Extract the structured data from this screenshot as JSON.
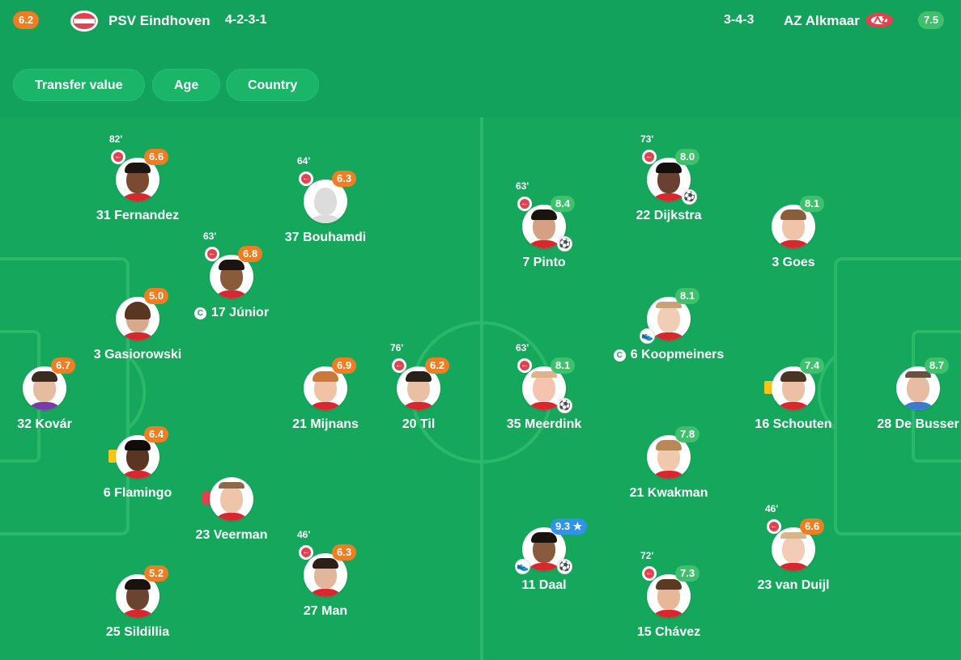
{
  "header": {
    "home": {
      "rating": "6.2",
      "name": "PSV Eindhoven",
      "formation": "4-2-3-1",
      "logo_icon": "psv-logo-icon"
    },
    "away": {
      "rating": "7.5",
      "name": "AZ Alkmaar",
      "formation": "3-4-3",
      "logo_icon": "az-logo-icon"
    }
  },
  "filters": [
    "Transfer value",
    "Age",
    "Country"
  ],
  "home_players": [
    {
      "id": "fernandez",
      "number_name": "31 Fernandez",
      "rating": "6.6",
      "minute": "82'",
      "sub_off": true
    },
    {
      "id": "bouhamdi",
      "number_name": "37 Bouhamdi",
      "rating": "6.3",
      "minute": "64'",
      "sub_off": true,
      "ghost": true
    },
    {
      "id": "junior",
      "number_name": "17 Júnior",
      "rating": "6.8",
      "minute": "63'",
      "sub_off": true,
      "captain": true
    },
    {
      "id": "gasiorowski",
      "number_name": "3 Gasiorowski",
      "rating": "5.0"
    },
    {
      "id": "kovar",
      "number_name": "32 Kovár",
      "rating": "6.7"
    },
    {
      "id": "mijnans",
      "number_name": "21 Mijnans",
      "rating": "6.9"
    },
    {
      "id": "til",
      "number_name": "20 Til",
      "rating": "6.2",
      "minute": "76'",
      "sub_off": true
    },
    {
      "id": "flamingo",
      "number_name": "6 Flamingo",
      "rating": "6.4",
      "card": "yellow"
    },
    {
      "id": "veerman",
      "number_name": "23 Veerman",
      "card": "red"
    },
    {
      "id": "man",
      "number_name": "27 Man",
      "rating": "6.3",
      "minute": "46'",
      "sub_off": true
    },
    {
      "id": "sildillia",
      "number_name": "25 Sildillia",
      "rating": "5.2"
    }
  ],
  "away_players": [
    {
      "id": "dijkstra",
      "number_name": "22 Dijkstra",
      "rating": "8.0",
      "minute": "73'",
      "sub_off": true,
      "goal": true
    },
    {
      "id": "pinto",
      "number_name": "7 Pinto",
      "rating": "8.4",
      "minute": "63'",
      "sub_off": true,
      "goal": true
    },
    {
      "id": "goes",
      "number_name": "3 Goes",
      "rating": "8.1"
    },
    {
      "id": "koopmeiners",
      "number_name": "6 Koopmeiners",
      "rating": "8.1",
      "captain": true,
      "assist": true
    },
    {
      "id": "meerdink",
      "number_name": "35 Meerdink",
      "rating": "8.1",
      "minute": "63'",
      "sub_off": true,
      "goal": true
    },
    {
      "id": "schouten",
      "number_name": "16 Schouten",
      "rating": "7.4",
      "card": "yellow"
    },
    {
      "id": "debusser",
      "number_name": "28 De Busser",
      "rating": "8.7"
    },
    {
      "id": "kwakman",
      "number_name": "21 Kwakman",
      "rating": "7.8"
    },
    {
      "id": "daal",
      "number_name": "11 Daal",
      "rating": "9.3 ★",
      "motm": true,
      "goal": true,
      "assist": true
    },
    {
      "id": "chavez",
      "number_name": "15 Chávez",
      "rating": "7.3",
      "minute": "72'",
      "sub_off": true
    },
    {
      "id": "vanduijl",
      "number_name": "23 van Duijl",
      "rating": "6.6",
      "minute": "46'",
      "sub_off": true
    }
  ],
  "colors": {
    "home_rating": "#ef7d22",
    "away_rating": "#3fc06c",
    "motm": "#2f93e9",
    "pitch": "#15a85c"
  }
}
